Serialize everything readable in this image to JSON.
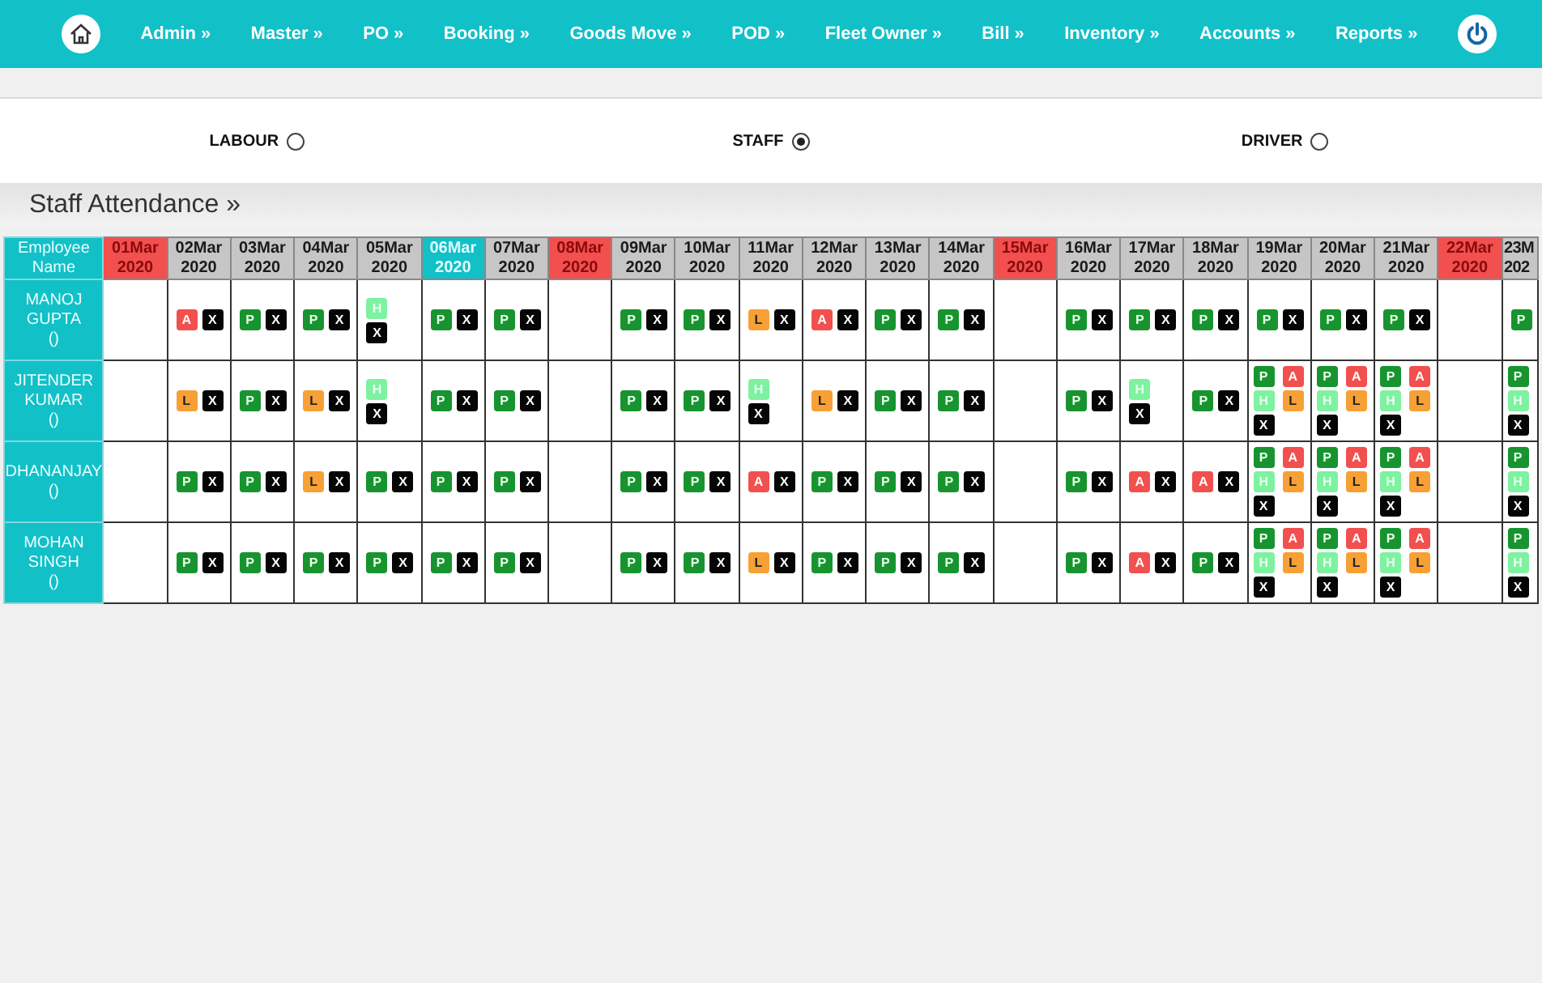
{
  "nav": {
    "items": [
      "Admin »",
      "Master »",
      "PO »",
      "Booking »",
      "Goods Move »",
      "POD »",
      "Fleet Owner »",
      "Bill »",
      "Inventory »",
      "Accounts »",
      "Reports »"
    ]
  },
  "staff_types": [
    {
      "label": "LABOUR",
      "selected": false
    },
    {
      "label": "STAFF",
      "selected": true
    },
    {
      "label": "DRIVER",
      "selected": false
    }
  ],
  "section_title": "Staff Attendance »",
  "table": {
    "name_header": "Employee Name",
    "dates": [
      {
        "day": "01Mar",
        "year": "2020",
        "kind": "holiday"
      },
      {
        "day": "02Mar",
        "year": "2020",
        "kind": "normal"
      },
      {
        "day": "03Mar",
        "year": "2020",
        "kind": "normal"
      },
      {
        "day": "04Mar",
        "year": "2020",
        "kind": "normal"
      },
      {
        "day": "05Mar",
        "year": "2020",
        "kind": "normal"
      },
      {
        "day": "06Mar",
        "year": "2020",
        "kind": "today"
      },
      {
        "day": "07Mar",
        "year": "2020",
        "kind": "normal"
      },
      {
        "day": "08Mar",
        "year": "2020",
        "kind": "holiday"
      },
      {
        "day": "09Mar",
        "year": "2020",
        "kind": "normal"
      },
      {
        "day": "10Mar",
        "year": "2020",
        "kind": "normal"
      },
      {
        "day": "11Mar",
        "year": "2020",
        "kind": "normal"
      },
      {
        "day": "12Mar",
        "year": "2020",
        "kind": "normal"
      },
      {
        "day": "13Mar",
        "year": "2020",
        "kind": "normal"
      },
      {
        "day": "14Mar",
        "year": "2020",
        "kind": "normal"
      },
      {
        "day": "15Mar",
        "year": "2020",
        "kind": "holiday"
      },
      {
        "day": "16Mar",
        "year": "2020",
        "kind": "normal"
      },
      {
        "day": "17Mar",
        "year": "2020",
        "kind": "normal"
      },
      {
        "day": "18Mar",
        "year": "2020",
        "kind": "normal"
      },
      {
        "day": "19Mar",
        "year": "2020",
        "kind": "normal"
      },
      {
        "day": "20Mar",
        "year": "2020",
        "kind": "normal"
      },
      {
        "day": "21Mar",
        "year": "2020",
        "kind": "normal"
      },
      {
        "day": "22Mar",
        "year": "2020",
        "kind": "holiday"
      },
      {
        "day": "23M",
        "year": "202",
        "kind": "normal"
      }
    ],
    "rows": [
      {
        "name": "MANOJ GUPTA",
        "sub": "()",
        "cells": [
          {},
          {
            "badges": [
              {
                "kind": "absent",
                "text": "A"
              },
              {
                "kind": "cross",
                "text": "X"
              }
            ]
          },
          {
            "badges": [
              {
                "kind": "present",
                "text": "P"
              },
              {
                "kind": "cross",
                "text": "X"
              }
            ]
          },
          {
            "badges": [
              {
                "kind": "present",
                "text": "P"
              },
              {
                "kind": "cross",
                "text": "X"
              }
            ]
          },
          {
            "badges": [
              {
                "kind": "half",
                "text": "H"
              },
              {
                "kind": "cross",
                "text": "X"
              }
            ]
          },
          {
            "badges": [
              {
                "kind": "present",
                "text": "P"
              },
              {
                "kind": "cross",
                "text": "X"
              }
            ]
          },
          {
            "badges": [
              {
                "kind": "present",
                "text": "P"
              },
              {
                "kind": "cross",
                "text": "X"
              }
            ]
          },
          {},
          {
            "badges": [
              {
                "kind": "present",
                "text": "P"
              },
              {
                "kind": "cross",
                "text": "X"
              }
            ]
          },
          {
            "badges": [
              {
                "kind": "present",
                "text": "P"
              },
              {
                "kind": "cross",
                "text": "X"
              }
            ]
          },
          {
            "badges": [
              {
                "kind": "leave",
                "text": "L"
              },
              {
                "kind": "cross",
                "text": "X"
              }
            ]
          },
          {
            "badges": [
              {
                "kind": "absent",
                "text": "A"
              },
              {
                "kind": "cross",
                "text": "X"
              }
            ]
          },
          {
            "badges": [
              {
                "kind": "present",
                "text": "P"
              },
              {
                "kind": "cross",
                "text": "X"
              }
            ]
          },
          {
            "badges": [
              {
                "kind": "present",
                "text": "P"
              },
              {
                "kind": "cross",
                "text": "X"
              }
            ]
          },
          {},
          {
            "badges": [
              {
                "kind": "present",
                "text": "P"
              },
              {
                "kind": "cross",
                "text": "X"
              }
            ]
          },
          {
            "badges": [
              {
                "kind": "present",
                "text": "P"
              },
              {
                "kind": "cross",
                "text": "X"
              }
            ]
          },
          {
            "badges": [
              {
                "kind": "present",
                "text": "P"
              },
              {
                "kind": "cross",
                "text": "X"
              }
            ]
          },
          {
            "badges": [
              {
                "kind": "present",
                "text": "P"
              },
              {
                "kind": "cross",
                "text": "X"
              }
            ]
          },
          {
            "badges": [
              {
                "kind": "present",
                "text": "P"
              },
              {
                "kind": "cross",
                "text": "X"
              }
            ]
          },
          {
            "badges": [
              {
                "kind": "present",
                "text": "P"
              },
              {
                "kind": "cross",
                "text": "X"
              }
            ]
          },
          {},
          {
            "badges": [
              {
                "kind": "present",
                "text": "P"
              }
            ]
          }
        ]
      },
      {
        "name": "JITENDER KUMAR",
        "sub": "()",
        "cells": [
          {},
          {
            "badges": [
              {
                "kind": "leave",
                "text": "L"
              },
              {
                "kind": "cross",
                "text": "X"
              }
            ]
          },
          {
            "badges": [
              {
                "kind": "present",
                "text": "P"
              },
              {
                "kind": "cross",
                "text": "X"
              }
            ]
          },
          {
            "badges": [
              {
                "kind": "leave",
                "text": "L"
              },
              {
                "kind": "cross",
                "text": "X"
              }
            ]
          },
          {
            "badges": [
              {
                "kind": "half",
                "text": "H"
              },
              {
                "kind": "cross",
                "text": "X"
              }
            ]
          },
          {
            "badges": [
              {
                "kind": "present",
                "text": "P"
              },
              {
                "kind": "cross",
                "text": "X"
              }
            ]
          },
          {
            "badges": [
              {
                "kind": "present",
                "text": "P"
              },
              {
                "kind": "cross",
                "text": "X"
              }
            ]
          },
          {},
          {
            "badges": [
              {
                "kind": "present",
                "text": "P"
              },
              {
                "kind": "cross",
                "text": "X"
              }
            ]
          },
          {
            "badges": [
              {
                "kind": "present",
                "text": "P"
              },
              {
                "kind": "cross",
                "text": "X"
              }
            ]
          },
          {
            "badges": [
              {
                "kind": "half",
                "text": "H"
              },
              {
                "kind": "cross",
                "text": "X"
              }
            ]
          },
          {
            "badges": [
              {
                "kind": "leave",
                "text": "L"
              },
              {
                "kind": "cross",
                "text": "X"
              }
            ]
          },
          {
            "badges": [
              {
                "kind": "present",
                "text": "P"
              },
              {
                "kind": "cross",
                "text": "X"
              }
            ]
          },
          {
            "badges": [
              {
                "kind": "present",
                "text": "P"
              },
              {
                "kind": "cross",
                "text": "X"
              }
            ]
          },
          {},
          {
            "badges": [
              {
                "kind": "present",
                "text": "P"
              },
              {
                "kind": "cross",
                "text": "X"
              }
            ]
          },
          {
            "badges": [
              {
                "kind": "half",
                "text": "H"
              },
              {
                "kind": "cross",
                "text": "X"
              }
            ]
          },
          {
            "badges": [
              {
                "kind": "present",
                "text": "P"
              },
              {
                "kind": "cross",
                "text": "X"
              }
            ]
          },
          {
            "badges": [
              {
                "kind": "present",
                "text": "P"
              },
              {
                "kind": "absent",
                "text": "A"
              },
              {
                "kind": "half",
                "text": "H"
              },
              {
                "kind": "leave",
                "text": "L"
              },
              {
                "kind": "cross",
                "text": "X"
              }
            ]
          },
          {
            "badges": [
              {
                "kind": "present",
                "text": "P"
              },
              {
                "kind": "absent",
                "text": "A"
              },
              {
                "kind": "half",
                "text": "H"
              },
              {
                "kind": "leave",
                "text": "L"
              },
              {
                "kind": "cross",
                "text": "X"
              }
            ]
          },
          {
            "badges": [
              {
                "kind": "present",
                "text": "P"
              },
              {
                "kind": "absent",
                "text": "A"
              },
              {
                "kind": "half",
                "text": "H"
              },
              {
                "kind": "leave",
                "text": "L"
              },
              {
                "kind": "cross",
                "text": "X"
              }
            ]
          },
          {},
          {
            "badges": [
              {
                "kind": "present",
                "text": "P"
              },
              {
                "kind": "half",
                "text": "H"
              },
              {
                "kind": "cross",
                "text": "X"
              }
            ]
          }
        ]
      },
      {
        "name": "DHANANJAY",
        "sub": "()",
        "cells": [
          {},
          {
            "badges": [
              {
                "kind": "present",
                "text": "P"
              },
              {
                "kind": "cross",
                "text": "X"
              }
            ]
          },
          {
            "badges": [
              {
                "kind": "present",
                "text": "P"
              },
              {
                "kind": "cross",
                "text": "X"
              }
            ]
          },
          {
            "badges": [
              {
                "kind": "leave",
                "text": "L"
              },
              {
                "kind": "cross",
                "text": "X"
              }
            ]
          },
          {
            "badges": [
              {
                "kind": "present",
                "text": "P"
              },
              {
                "kind": "cross",
                "text": "X"
              }
            ]
          },
          {
            "badges": [
              {
                "kind": "present",
                "text": "P"
              },
              {
                "kind": "cross",
                "text": "X"
              }
            ]
          },
          {
            "badges": [
              {
                "kind": "present",
                "text": "P"
              },
              {
                "kind": "cross",
                "text": "X"
              }
            ]
          },
          {},
          {
            "badges": [
              {
                "kind": "present",
                "text": "P"
              },
              {
                "kind": "cross",
                "text": "X"
              }
            ]
          },
          {
            "badges": [
              {
                "kind": "present",
                "text": "P"
              },
              {
                "kind": "cross",
                "text": "X"
              }
            ]
          },
          {
            "badges": [
              {
                "kind": "absent",
                "text": "A"
              },
              {
                "kind": "cross",
                "text": "X"
              }
            ]
          },
          {
            "badges": [
              {
                "kind": "present",
                "text": "P"
              },
              {
                "kind": "cross",
                "text": "X"
              }
            ]
          },
          {
            "badges": [
              {
                "kind": "present",
                "text": "P"
              },
              {
                "kind": "cross",
                "text": "X"
              }
            ]
          },
          {
            "badges": [
              {
                "kind": "present",
                "text": "P"
              },
              {
                "kind": "cross",
                "text": "X"
              }
            ]
          },
          {},
          {
            "badges": [
              {
                "kind": "present",
                "text": "P"
              },
              {
                "kind": "cross",
                "text": "X"
              }
            ]
          },
          {
            "badges": [
              {
                "kind": "absent",
                "text": "A"
              },
              {
                "kind": "cross",
                "text": "X"
              }
            ]
          },
          {
            "badges": [
              {
                "kind": "absent",
                "text": "A"
              },
              {
                "kind": "cross",
                "text": "X"
              }
            ]
          },
          {
            "badges": [
              {
                "kind": "present",
                "text": "P"
              },
              {
                "kind": "absent",
                "text": "A"
              },
              {
                "kind": "half",
                "text": "H"
              },
              {
                "kind": "leave",
                "text": "L"
              },
              {
                "kind": "cross",
                "text": "X"
              }
            ]
          },
          {
            "badges": [
              {
                "kind": "present",
                "text": "P"
              },
              {
                "kind": "absent",
                "text": "A"
              },
              {
                "kind": "half",
                "text": "H"
              },
              {
                "kind": "leave",
                "text": "L"
              },
              {
                "kind": "cross",
                "text": "X"
              }
            ]
          },
          {
            "badges": [
              {
                "kind": "present",
                "text": "P"
              },
              {
                "kind": "absent",
                "text": "A"
              },
              {
                "kind": "half",
                "text": "H"
              },
              {
                "kind": "leave",
                "text": "L"
              },
              {
                "kind": "cross",
                "text": "X"
              }
            ]
          },
          {},
          {
            "badges": [
              {
                "kind": "present",
                "text": "P"
              },
              {
                "kind": "half",
                "text": "H"
              },
              {
                "kind": "cross",
                "text": "X"
              }
            ]
          }
        ]
      },
      {
        "name": "MOHAN SINGH",
        "sub": "()",
        "cells": [
          {},
          {
            "badges": [
              {
                "kind": "present",
                "text": "P"
              },
              {
                "kind": "cross",
                "text": "X"
              }
            ]
          },
          {
            "badges": [
              {
                "kind": "present",
                "text": "P"
              },
              {
                "kind": "cross",
                "text": "X"
              }
            ]
          },
          {
            "badges": [
              {
                "kind": "present",
                "text": "P"
              },
              {
                "kind": "cross",
                "text": "X"
              }
            ]
          },
          {
            "badges": [
              {
                "kind": "present",
                "text": "P"
              },
              {
                "kind": "cross",
                "text": "X"
              }
            ]
          },
          {
            "badges": [
              {
                "kind": "present",
                "text": "P"
              },
              {
                "kind": "cross",
                "text": "X"
              }
            ]
          },
          {
            "badges": [
              {
                "kind": "present",
                "text": "P"
              },
              {
                "kind": "cross",
                "text": "X"
              }
            ]
          },
          {},
          {
            "badges": [
              {
                "kind": "present",
                "text": "P"
              },
              {
                "kind": "cross",
                "text": "X"
              }
            ]
          },
          {
            "badges": [
              {
                "kind": "present",
                "text": "P"
              },
              {
                "kind": "cross",
                "text": "X"
              }
            ]
          },
          {
            "badges": [
              {
                "kind": "leave",
                "text": "L"
              },
              {
                "kind": "cross",
                "text": "X"
              }
            ]
          },
          {
            "badges": [
              {
                "kind": "present",
                "text": "P"
              },
              {
                "kind": "cross",
                "text": "X"
              }
            ]
          },
          {
            "badges": [
              {
                "kind": "present",
                "text": "P"
              },
              {
                "kind": "cross",
                "text": "X"
              }
            ]
          },
          {
            "badges": [
              {
                "kind": "present",
                "text": "P"
              },
              {
                "kind": "cross",
                "text": "X"
              }
            ]
          },
          {},
          {
            "badges": [
              {
                "kind": "present",
                "text": "P"
              },
              {
                "kind": "cross",
                "text": "X"
              }
            ]
          },
          {
            "badges": [
              {
                "kind": "absent",
                "text": "A"
              },
              {
                "kind": "cross",
                "text": "X"
              }
            ]
          },
          {
            "badges": [
              {
                "kind": "present",
                "text": "P"
              },
              {
                "kind": "cross",
                "text": "X"
              }
            ]
          },
          {
            "badges": [
              {
                "kind": "present",
                "text": "P"
              },
              {
                "kind": "absent",
                "text": "A"
              },
              {
                "kind": "half",
                "text": "H"
              },
              {
                "kind": "leave",
                "text": "L"
              },
              {
                "kind": "cross",
                "text": "X"
              }
            ]
          },
          {
            "badges": [
              {
                "kind": "present",
                "text": "P"
              },
              {
                "kind": "absent",
                "text": "A"
              },
              {
                "kind": "half",
                "text": "H"
              },
              {
                "kind": "leave",
                "text": "L"
              },
              {
                "kind": "cross",
                "text": "X"
              }
            ]
          },
          {
            "badges": [
              {
                "kind": "present",
                "text": "P"
              },
              {
                "kind": "absent",
                "text": "A"
              },
              {
                "kind": "half",
                "text": "H"
              },
              {
                "kind": "leave",
                "text": "L"
              },
              {
                "kind": "cross",
                "text": "X"
              }
            ]
          },
          {},
          {
            "badges": [
              {
                "kind": "present",
                "text": "P"
              },
              {
                "kind": "half",
                "text": "H"
              },
              {
                "kind": "cross",
                "text": "X"
              }
            ]
          }
        ]
      }
    ]
  }
}
